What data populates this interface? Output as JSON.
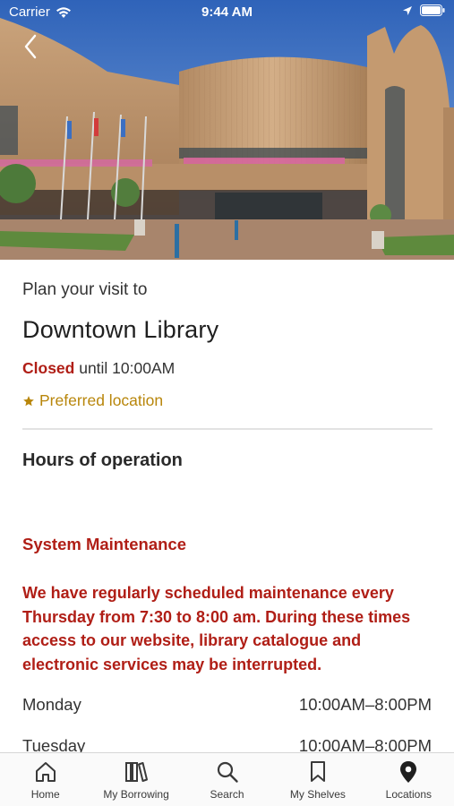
{
  "status_bar": {
    "carrier": "Carrier",
    "time": "9:44 AM"
  },
  "hero": {
    "image_subject": "library-building-photo"
  },
  "branch": {
    "intro": "Plan your visit to",
    "name": "Downtown Library",
    "status_word": "Closed",
    "status_detail": " until 10:00AM",
    "preferred_label": "Preferred location"
  },
  "hours": {
    "heading": "Hours of operation",
    "notice_title": "System Maintenance",
    "notice_body": "We have regularly scheduled maintenance every Thursday from 7:30 to 8:00 am. During these times access to our website, library catalogue and electronic services may be interrupted.",
    "rows": [
      {
        "day": "Monday",
        "time": "10:00AM–8:00PM"
      },
      {
        "day": "Tuesday",
        "time": "10:00AM–8:00PM"
      }
    ]
  },
  "tabbar": {
    "items": [
      {
        "label": "Home",
        "icon": "home-icon"
      },
      {
        "label": "My Borrowing",
        "icon": "books-icon"
      },
      {
        "label": "Search",
        "icon": "search-icon"
      },
      {
        "label": "My Shelves",
        "icon": "bookmark-icon"
      },
      {
        "label": "Locations",
        "icon": "location-pin-icon"
      }
    ]
  },
  "colors": {
    "accent_red": "#b01e16",
    "preferred_gold": "#b8860b",
    "text_dark": "#222222"
  }
}
